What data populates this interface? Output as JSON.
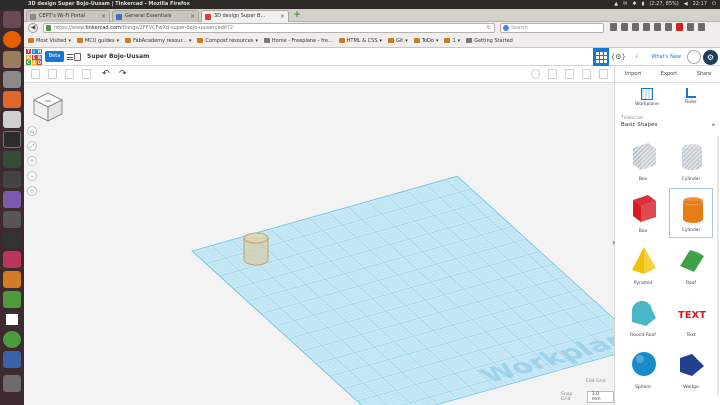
{
  "os": {
    "window_title": "3D design Super Bojo-Uusam | Tinkercad - Mozilla Firefox",
    "battery": "(2:27, 85%)",
    "clock": "22:17"
  },
  "tabs": [
    {
      "label": "CEPT's Wi-Fi Portal",
      "active": false
    },
    {
      "label": "General Essentials",
      "active": false
    },
    {
      "label": "3D design Super B...",
      "active": true
    }
  ],
  "navbar": {
    "url_prefix": "https://www.",
    "url_host": "tinkercad.com",
    "url_path": "/things/2FFVCFwXd-super-bojo-uusam/edit?2",
    "search_placeholder": "Search"
  },
  "bookmarks": [
    {
      "label": "Most Visited",
      "chevron": true
    },
    {
      "label": "MCU guides",
      "chevron": true
    },
    {
      "label": "FabAcademy resour...",
      "chevron": true
    },
    {
      "label": "Compost resources",
      "chevron": true
    },
    {
      "label": "Home - Freeplane - fre...",
      "chevron": false
    },
    {
      "label": "HTML & CSS",
      "chevron": true
    },
    {
      "label": "Git",
      "chevron": true
    },
    {
      "label": "ToDo",
      "chevron": true
    },
    {
      "label": "1",
      "chevron": true
    },
    {
      "label": "Getting Started",
      "chevron": false
    }
  ],
  "header": {
    "logo_letters": [
      "T",
      "I",
      "N",
      "K",
      "E",
      "R",
      "C",
      "A",
      "D"
    ],
    "beta_label": "Beta",
    "design_name": "Super Bojo-Uusam",
    "whats_new": "What's New"
  },
  "right_panel": {
    "tabs": [
      "Import",
      "Export",
      "Share"
    ],
    "tools": [
      {
        "label": "Workplane"
      },
      {
        "label": "Ruler"
      }
    ],
    "section_label": "Tinkercad",
    "shapes_category": "Basic Shapes",
    "shapes": [
      {
        "label": "Box",
        "kind": "box",
        "color": "#b9bec6",
        "striped": true
      },
      {
        "label": "Cylinder",
        "kind": "cylinder",
        "color": "#c3c8cf",
        "striped": true
      },
      {
        "label": "Box",
        "kind": "box",
        "color": "#d41d24",
        "striped": false
      },
      {
        "label": "Cylinder",
        "kind": "cylinder",
        "color": "#e77d16",
        "striped": false,
        "selected": true
      },
      {
        "label": "Pyramid",
        "kind": "pyramid",
        "color": "#f2c200"
      },
      {
        "label": "Roof",
        "kind": "roof",
        "color": "#3fa146"
      },
      {
        "label": "Round Roof",
        "kind": "roundroof",
        "color": "#48b8c8"
      },
      {
        "label": "Text",
        "kind": "text",
        "color": "#d41d24",
        "glyph": "TEXT"
      },
      {
        "label": "Sphere",
        "kind": "sphere",
        "color": "#1a8ac8"
      },
      {
        "label": "Wedge",
        "kind": "wedge",
        "color": "#22408f"
      }
    ]
  },
  "canvas": {
    "workplane_label": "Workplane",
    "edit_grid": "Edit Grid",
    "snap_label": "Snap Grid",
    "snap_value": "1.0 mm"
  }
}
